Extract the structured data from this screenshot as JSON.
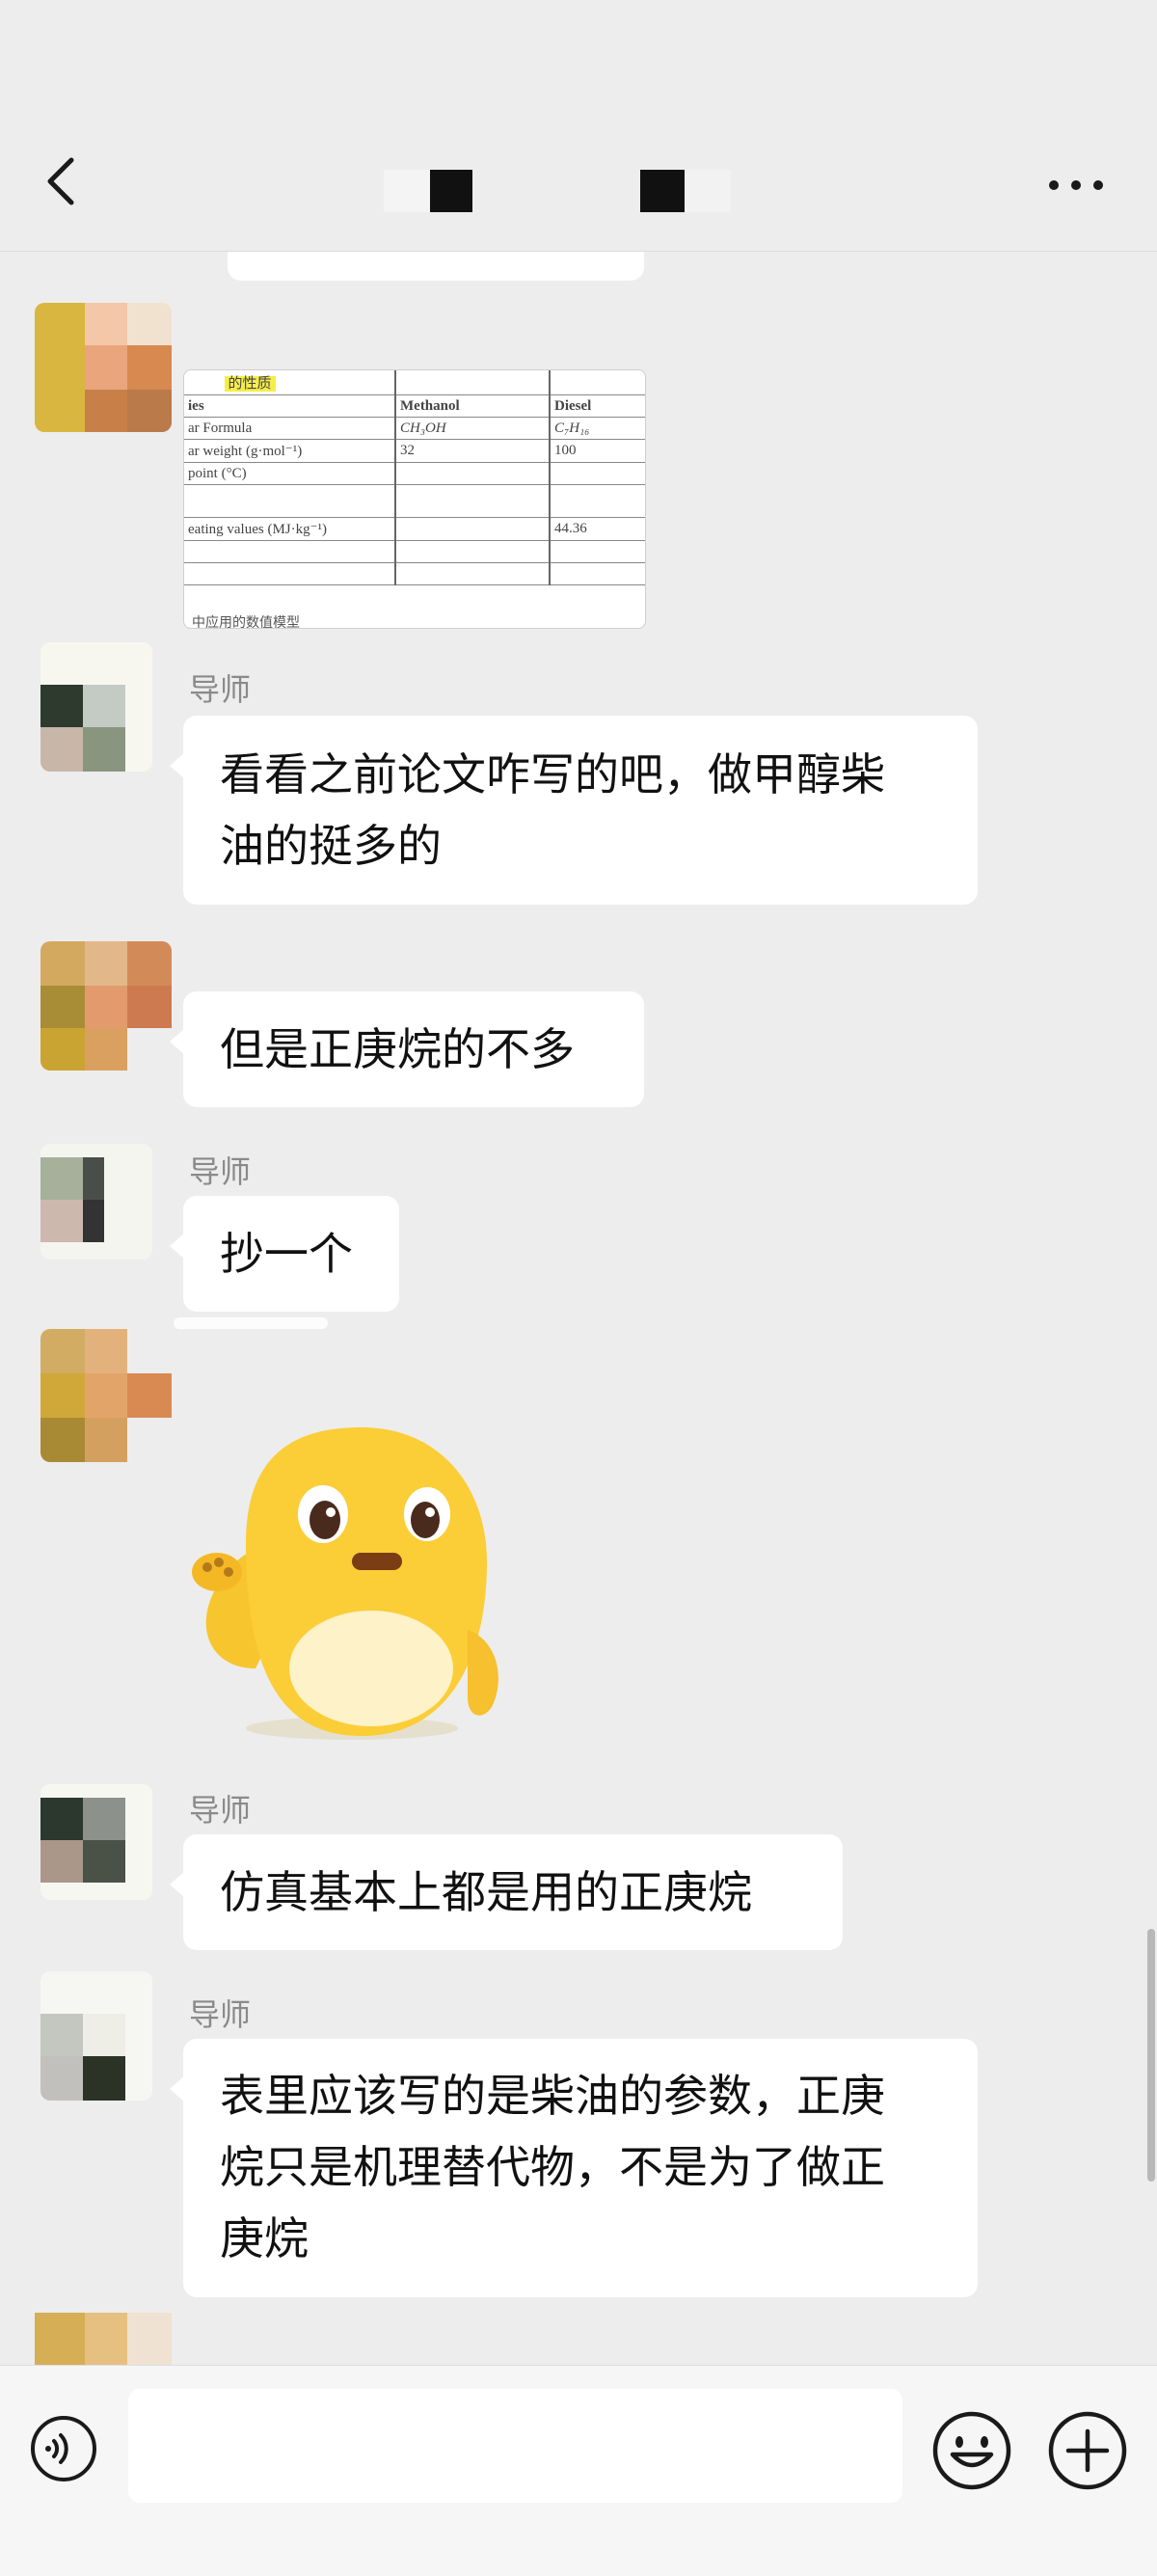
{
  "header": {
    "back_icon": "chevron-left-icon",
    "more_icon": "more-horizontal-icon"
  },
  "table_image": {
    "highlight_text": "的性质",
    "columns": [
      "ies",
      "Methanol",
      "Diesel"
    ],
    "rows": [
      [
        "ar Formula",
        "CH₃OH",
        "C₇H₁₆"
      ],
      [
        "ar weight (g·mol⁻¹)",
        "32",
        "100"
      ],
      [
        "point (°C)",
        "",
        ""
      ],
      [
        "",
        "",
        ""
      ],
      [
        "eating values (MJ·kg⁻¹)",
        "",
        "44.36"
      ],
      [
        "",
        "",
        ""
      ],
      [
        "",
        "",
        ""
      ]
    ],
    "caption": "中应用的数值模型"
  },
  "messages": [
    {
      "sender": "导师",
      "text_lines": [
        "看看之前论文咋写的吧，做甲醇柴",
        "油的挺多的"
      ]
    },
    {
      "text_lines": [
        "但是正庚烷的不多"
      ]
    },
    {
      "sender": "导师",
      "text_lines": [
        "抄一个"
      ]
    },
    {
      "sender": "导师",
      "text_lines": [
        "仿真基本上都是用的正庚烷"
      ]
    },
    {
      "sender": "导师",
      "text_lines": [
        "表里应该写的是柴油的参数，正庚",
        "烷只是机理替代物，不是为了做正",
        "庚烷"
      ]
    }
  ],
  "sticker": {
    "name": "yellow-chick-sticker"
  },
  "input_bar": {
    "voice_icon": "voice-icon",
    "emoji_icon": "emoji-smile-icon",
    "plus_icon": "plus-circle-icon",
    "input_value": ""
  },
  "colors": {
    "background": "#ededed",
    "bubble": "#ffffff",
    "sender_name": "#8a8a8a",
    "highlight": "#f5ee4a"
  }
}
